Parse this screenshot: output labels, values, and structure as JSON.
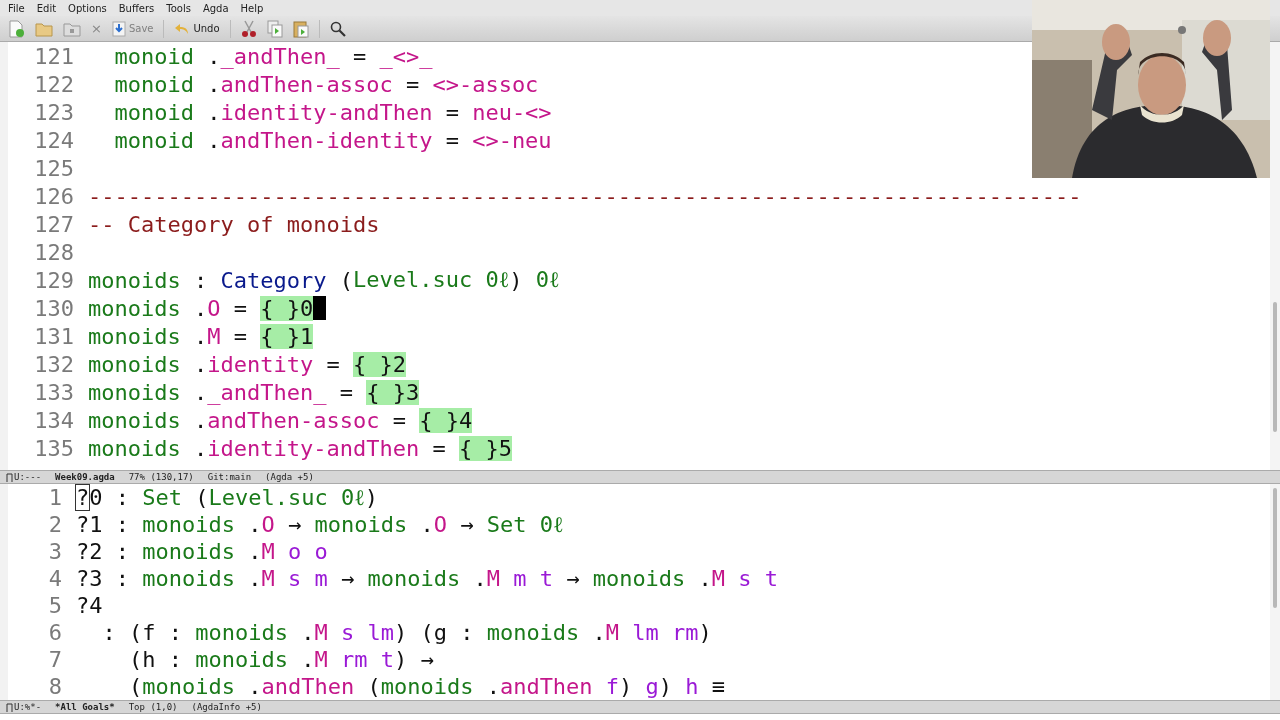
{
  "menu": [
    "File",
    "Edit",
    "Options",
    "Buffers",
    "Tools",
    "Agda",
    "Help"
  ],
  "toolbar": [
    {
      "kind": "new"
    },
    {
      "kind": "open"
    },
    {
      "kind": "dired"
    },
    {
      "kind": "close",
      "glyph": "×"
    },
    {
      "kind": "save",
      "label": "Save",
      "disabled": true
    },
    {
      "kind": "undo",
      "label": "Undo",
      "disabled": false
    },
    {
      "kind": "cut"
    },
    {
      "kind": "copy"
    },
    {
      "kind": "paste"
    },
    {
      "kind": "search"
    }
  ],
  "webcam": {
    "kind": "picture"
  },
  "editor": {
    "lines": [
      {
        "n": "121",
        "tokens": [
          {
            "t": "  monoid",
            "kind": "fn"
          },
          {
            "t": " .",
            "kind": "plain"
          },
          {
            "t": "_andThen_",
            "kind": "field"
          },
          {
            "t": " = ",
            "kind": "plain"
          },
          {
            "t": "_<>_",
            "kind": "field"
          }
        ]
      },
      {
        "n": "122",
        "tokens": [
          {
            "t": "  monoid",
            "kind": "fn"
          },
          {
            "t": " .",
            "kind": "plain"
          },
          {
            "t": "andThen-assoc",
            "kind": "field"
          },
          {
            "t": " = ",
            "kind": "plain"
          },
          {
            "t": "<>-assoc",
            "kind": "field"
          }
        ]
      },
      {
        "n": "123",
        "tokens": [
          {
            "t": "  monoid",
            "kind": "fn"
          },
          {
            "t": " .",
            "kind": "plain"
          },
          {
            "t": "identity-andThen",
            "kind": "field"
          },
          {
            "t": " = ",
            "kind": "plain"
          },
          {
            "t": "neu-<>",
            "kind": "field"
          }
        ]
      },
      {
        "n": "124",
        "tokens": [
          {
            "t": "  monoid",
            "kind": "fn"
          },
          {
            "t": " .",
            "kind": "plain"
          },
          {
            "t": "andThen-identity",
            "kind": "field"
          },
          {
            "t": " = ",
            "kind": "plain"
          },
          {
            "t": "<>-neu",
            "kind": "field"
          }
        ]
      },
      {
        "n": "125"
      },
      {
        "n": "126",
        "tokens": [
          {
            "t": "---------------------------------------------------------------------------",
            "kind": "comment"
          }
        ]
      },
      {
        "n": "127",
        "tokens": [
          {
            "t": "-- Category of monoids",
            "kind": "comment"
          }
        ]
      },
      {
        "n": "128"
      },
      {
        "n": "129",
        "tokens": [
          {
            "t": "monoids",
            "kind": "fn"
          },
          {
            "t": " : ",
            "kind": "plain"
          },
          {
            "t": "Category",
            "kind": "type"
          },
          {
            "t": " (",
            "kind": "plain"
          },
          {
            "t": "Level.suc 0ℓ",
            "kind": "fn"
          },
          {
            "t": ") ",
            "kind": "plain"
          },
          {
            "t": "0ℓ",
            "kind": "fn"
          }
        ]
      },
      {
        "n": "130",
        "cursor": true,
        "tokens": [
          {
            "t": "monoids",
            "kind": "fn"
          },
          {
            "t": " .",
            "kind": "plain"
          },
          {
            "t": "O",
            "kind": "field"
          },
          {
            "t": " = ",
            "kind": "plain"
          },
          {
            "t": "{ }0",
            "kind": "hole"
          }
        ]
      },
      {
        "n": "131",
        "tokens": [
          {
            "t": "monoids",
            "kind": "fn"
          },
          {
            "t": " .",
            "kind": "plain"
          },
          {
            "t": "M",
            "kind": "field"
          },
          {
            "t": " = ",
            "kind": "plain"
          },
          {
            "t": "{ }1",
            "kind": "hole"
          }
        ]
      },
      {
        "n": "132",
        "tokens": [
          {
            "t": "monoids",
            "kind": "fn"
          },
          {
            "t": " .",
            "kind": "plain"
          },
          {
            "t": "identity",
            "kind": "field"
          },
          {
            "t": " = ",
            "kind": "plain"
          },
          {
            "t": "{ }2",
            "kind": "hole"
          }
        ]
      },
      {
        "n": "133",
        "tokens": [
          {
            "t": "monoids",
            "kind": "fn"
          },
          {
            "t": " .",
            "kind": "plain"
          },
          {
            "t": "_andThen_",
            "kind": "field"
          },
          {
            "t": " = ",
            "kind": "plain"
          },
          {
            "t": "{ }3",
            "kind": "hole"
          }
        ]
      },
      {
        "n": "134",
        "tokens": [
          {
            "t": "monoids",
            "kind": "fn"
          },
          {
            "t": " .",
            "kind": "plain"
          },
          {
            "t": "andThen-assoc",
            "kind": "field"
          },
          {
            "t": " = ",
            "kind": "plain"
          },
          {
            "t": "{ }4",
            "kind": "hole"
          }
        ]
      },
      {
        "n": "135",
        "tokens": [
          {
            "t": "monoids",
            "kind": "fn"
          },
          {
            "t": " .",
            "kind": "plain"
          },
          {
            "t": "identity-andThen",
            "kind": "field"
          },
          {
            "t": " = ",
            "kind": "plain"
          },
          {
            "t": "{ }5",
            "kind": "hole"
          }
        ]
      }
    ]
  },
  "editor_modeline": {
    "state": "U:---",
    "buffer": "Week09.agda",
    "position": "77% (130,17)",
    "vc": "Git:main",
    "mode": "(Agda +5)"
  },
  "goals": {
    "lines": [
      {
        "n": "1",
        "tokens": [
          {
            "t": "?",
            "kind": "boxed"
          },
          {
            "t": "0 : ",
            "kind": "plain"
          },
          {
            "t": "Set",
            "kind": "fn"
          },
          {
            "t": " (",
            "kind": "plain"
          },
          {
            "t": "Level.suc 0ℓ",
            "kind": "fn"
          },
          {
            "t": ")",
            "kind": "plain"
          }
        ]
      },
      {
        "n": "2",
        "tokens": [
          {
            "t": "?1 : ",
            "kind": "plain"
          },
          {
            "t": "monoids",
            "kind": "fn"
          },
          {
            "t": " .",
            "kind": "plain"
          },
          {
            "t": "O",
            "kind": "field"
          },
          {
            "t": " → ",
            "kind": "plain"
          },
          {
            "t": "monoids",
            "kind": "fn"
          },
          {
            "t": " .",
            "kind": "plain"
          },
          {
            "t": "O",
            "kind": "field"
          },
          {
            "t": " → ",
            "kind": "plain"
          },
          {
            "t": "Set 0ℓ",
            "kind": "fn"
          }
        ]
      },
      {
        "n": "3",
        "tokens": [
          {
            "t": "?2 : ",
            "kind": "plain"
          },
          {
            "t": "monoids",
            "kind": "fn"
          },
          {
            "t": " .",
            "kind": "plain"
          },
          {
            "t": "M",
            "kind": "field"
          },
          {
            "t": " o o",
            "kind": "var"
          }
        ]
      },
      {
        "n": "4",
        "tokens": [
          {
            "t": "?3 : ",
            "kind": "plain"
          },
          {
            "t": "monoids",
            "kind": "fn"
          },
          {
            "t": " .",
            "kind": "plain"
          },
          {
            "t": "M",
            "kind": "field"
          },
          {
            "t": " s m",
            "kind": "var"
          },
          {
            "t": " → ",
            "kind": "plain"
          },
          {
            "t": "monoids",
            "kind": "fn"
          },
          {
            "t": " .",
            "kind": "plain"
          },
          {
            "t": "M",
            "kind": "field"
          },
          {
            "t": " m t",
            "kind": "var"
          },
          {
            "t": " → ",
            "kind": "plain"
          },
          {
            "t": "monoids",
            "kind": "fn"
          },
          {
            "t": " .",
            "kind": "plain"
          },
          {
            "t": "M",
            "kind": "field"
          },
          {
            "t": " s t",
            "kind": "var"
          }
        ]
      },
      {
        "n": "5",
        "tokens": [
          {
            "t": "?4",
            "kind": "plain"
          }
        ]
      },
      {
        "n": "6",
        "tokens": [
          {
            "t": "  : (f : ",
            "kind": "plain"
          },
          {
            "t": "monoids",
            "kind": "fn"
          },
          {
            "t": " .",
            "kind": "plain"
          },
          {
            "t": "M",
            "kind": "field"
          },
          {
            "t": " s lm",
            "kind": "var"
          },
          {
            "t": ") (g : ",
            "kind": "plain"
          },
          {
            "t": "monoids",
            "kind": "fn"
          },
          {
            "t": " .",
            "kind": "plain"
          },
          {
            "t": "M",
            "kind": "field"
          },
          {
            "t": " lm rm",
            "kind": "var"
          },
          {
            "t": ")",
            "kind": "plain"
          }
        ]
      },
      {
        "n": "7",
        "tokens": [
          {
            "t": "    (h : ",
            "kind": "plain"
          },
          {
            "t": "monoids",
            "kind": "fn"
          },
          {
            "t": " .",
            "kind": "plain"
          },
          {
            "t": "M",
            "kind": "field"
          },
          {
            "t": " rm t",
            "kind": "var"
          },
          {
            "t": ") →",
            "kind": "plain"
          }
        ]
      },
      {
        "n": "8",
        "tokens": [
          {
            "t": "    (",
            "kind": "plain"
          },
          {
            "t": "monoids",
            "kind": "fn"
          },
          {
            "t": " .",
            "kind": "plain"
          },
          {
            "t": "andThen",
            "kind": "field"
          },
          {
            "t": " (",
            "kind": "plain"
          },
          {
            "t": "monoids",
            "kind": "fn"
          },
          {
            "t": " .",
            "kind": "plain"
          },
          {
            "t": "andThen",
            "kind": "field"
          },
          {
            "t": " f",
            "kind": "var"
          },
          {
            "t": ") ",
            "kind": "plain"
          },
          {
            "t": "g",
            "kind": "var"
          },
          {
            "t": ") ",
            "kind": "plain"
          },
          {
            "t": "h",
            "kind": "var"
          },
          {
            "t": " ≡",
            "kind": "plain"
          }
        ]
      }
    ]
  },
  "goals_modeline": {
    "state": "U:%*-",
    "buffer": "*All Goals*",
    "position": "Top (1,0)",
    "mode": "(AgdaInfo +5)"
  }
}
